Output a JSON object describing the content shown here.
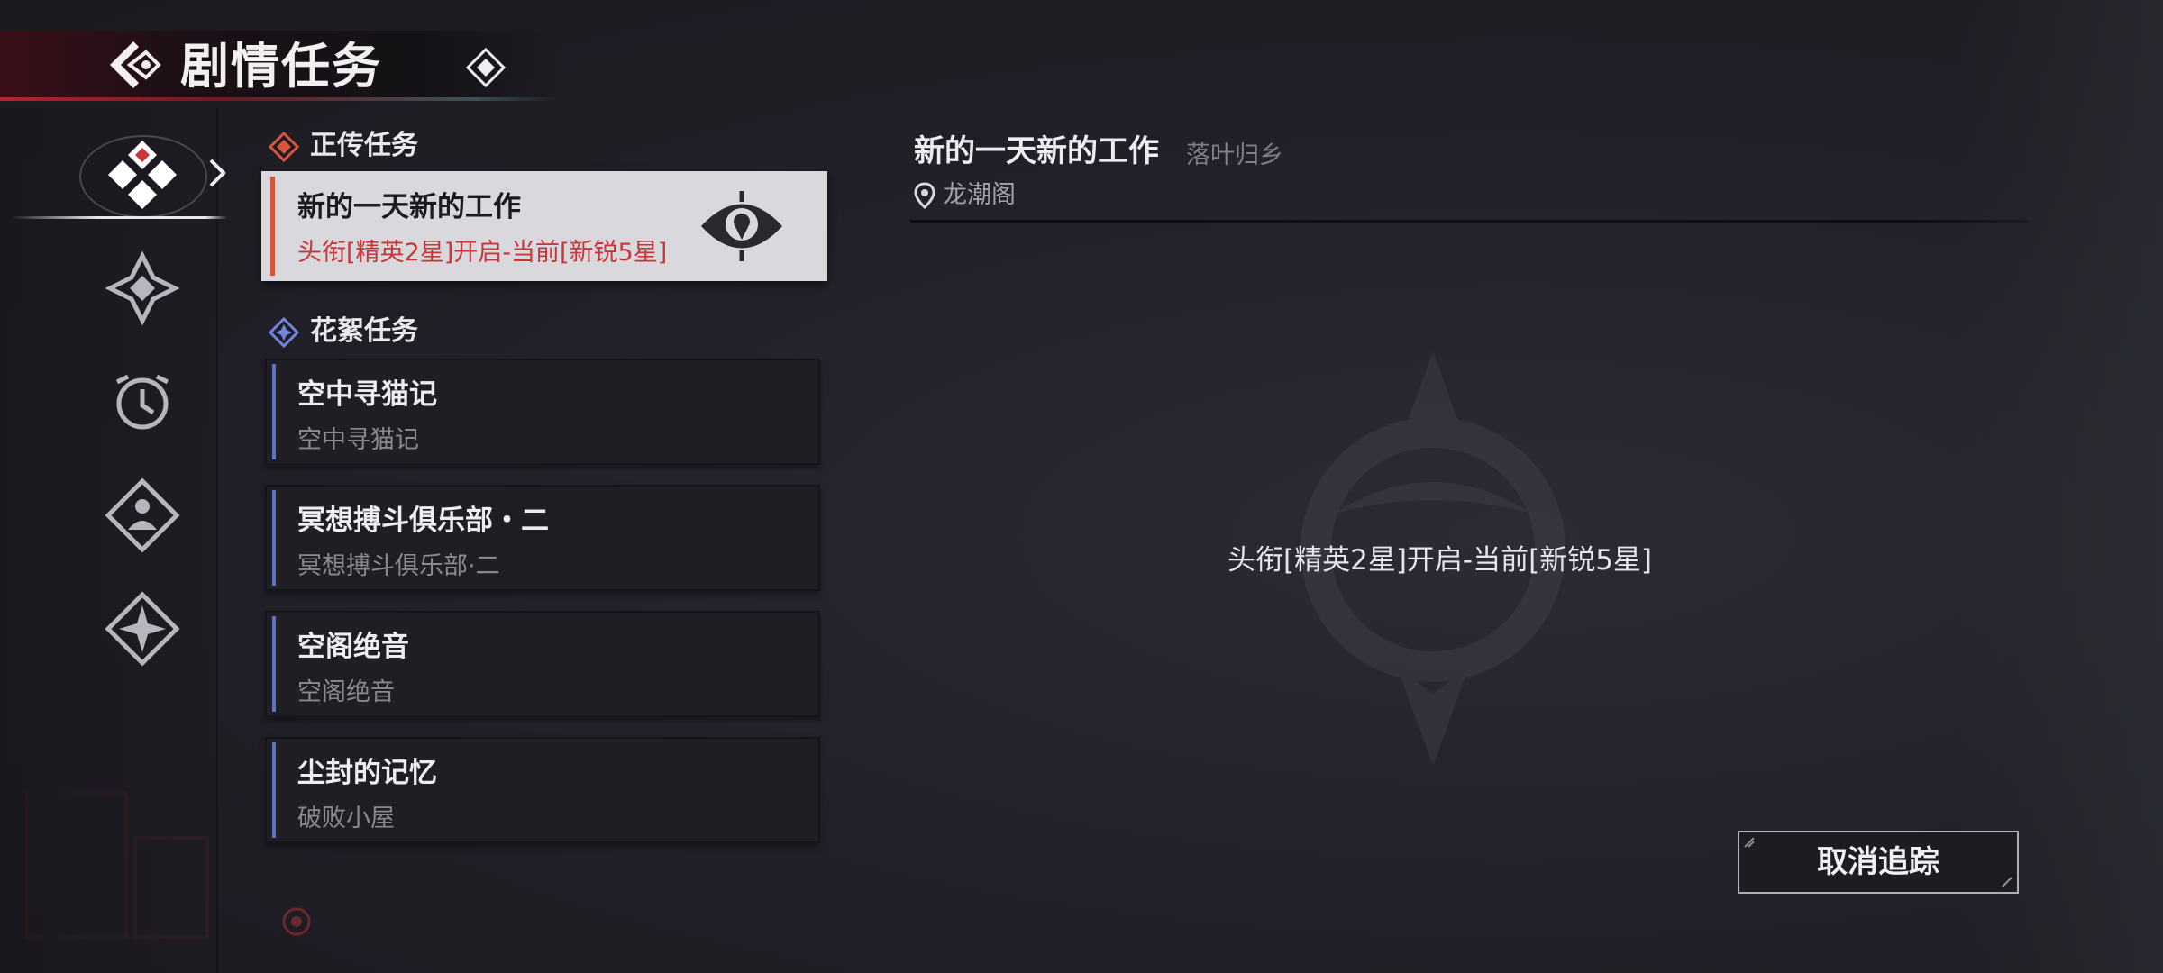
{
  "header": {
    "title": "剧情任务"
  },
  "rail": {
    "items": [
      {
        "icon": "four-diamond-icon",
        "active": true
      },
      {
        "icon": "compass-star-icon",
        "active": false
      },
      {
        "icon": "clock-icon",
        "active": false
      },
      {
        "icon": "person-diamond-icon",
        "active": false
      },
      {
        "icon": "four-point-star-icon",
        "active": false
      }
    ]
  },
  "main_quests": {
    "heading": "正传任务",
    "items": [
      {
        "name": "新的一天新的工作",
        "sub": "头衔[精英2星]开启-当前[新锐5星]",
        "tracked": true
      }
    ]
  },
  "side_quests": {
    "heading": "花絮任务",
    "items": [
      {
        "name": "空中寻猫记",
        "sub": "空中寻猫记"
      },
      {
        "name": "冥想搏斗俱乐部・二",
        "sub": "冥想搏斗俱乐部·二"
      },
      {
        "name": "空阁绝音",
        "sub": "空阁绝音"
      },
      {
        "name": "尘封的记忆",
        "sub": "破败小屋"
      }
    ]
  },
  "detail": {
    "title": "新的一天新的工作",
    "region": "落叶归乡",
    "location": "龙潮阁",
    "requirement": "头衔[精英2星]开启-当前[新锐5星]",
    "untrack_label": "取消追踪"
  },
  "colors": {
    "accent_red": "#c8363a",
    "main_bar": "#d8553d",
    "side_bar": "#5e72c6",
    "card_active_bg": "#d9d8dc"
  }
}
